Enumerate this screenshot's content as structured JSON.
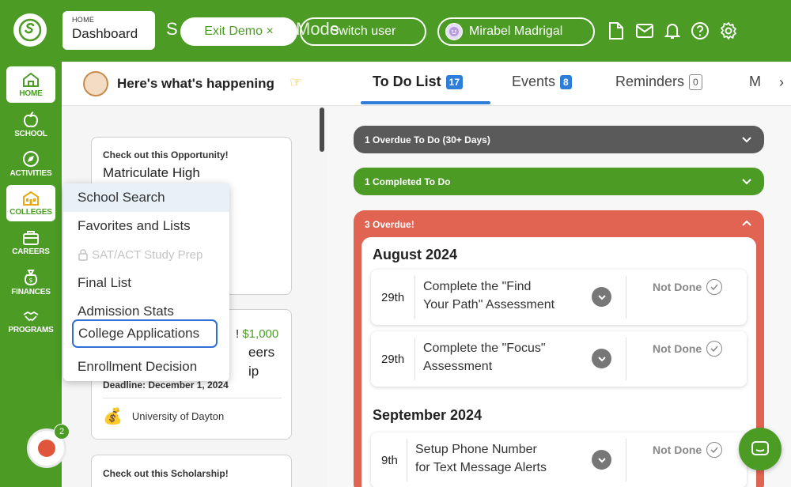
{
  "header": {
    "breadcrumb_small": "HOME",
    "breadcrumb_title": "Dashboard",
    "demo_mode_prefix": "S",
    "demo_mode_suffix": "Mode",
    "exit_demo_label": "Exit Demo ×",
    "switch_user_label": "Switch user",
    "user_name": "Mirabel Madrigal",
    "brand_color": "#4b9b25",
    "icons": [
      "document-icon",
      "mail-icon",
      "bell-icon",
      "help-icon",
      "settings-icon"
    ]
  },
  "sidebar": {
    "items": [
      {
        "label": "HOME",
        "icon": "home-icon"
      },
      {
        "label": "SCHOOL",
        "icon": "apple-icon"
      },
      {
        "label": "ACTIVITIES",
        "icon": "compass-icon"
      },
      {
        "label": "COLLEGES",
        "icon": "college-icon"
      },
      {
        "label": "CAREERS",
        "icon": "briefcase-icon"
      },
      {
        "label": "FINANCES",
        "icon": "money-bag-icon"
      },
      {
        "label": "PROGRAMS",
        "icon": "handshake-icon"
      }
    ],
    "record_badge": "2"
  },
  "feed": {
    "title": "Here's what's happening",
    "cards": [
      {
        "kicker": "Check out this Opportunity!",
        "title": "Matriculate High"
      },
      {
        "kicker": "",
        "title_prefix": "!",
        "money": "$1,000",
        "title_line2": "eers",
        "title_line3": "ip",
        "deadline": "Deadline: December 1, 2024",
        "org": "University of Dayton"
      },
      {
        "kicker": "Check out this Scholarship!"
      }
    ]
  },
  "colleges_menu": {
    "items": [
      {
        "label": "School Search",
        "state": "hover"
      },
      {
        "label": "Favorites and Lists",
        "state": "normal"
      },
      {
        "label": "SAT/ACT Study Prep",
        "state": "disabled"
      },
      {
        "label": "Final List",
        "state": "normal"
      },
      {
        "label": "Admission Stats",
        "state": "normal"
      },
      {
        "label": "College Applications",
        "state": "focused"
      },
      {
        "label": "Enrollment Decision",
        "state": "normal"
      }
    ]
  },
  "main": {
    "tabs": [
      {
        "label": "To Do List",
        "count": "17",
        "active": true
      },
      {
        "label": "Events",
        "count": "8",
        "active": false
      },
      {
        "label": "Reminders",
        "count": "0",
        "active": false
      },
      {
        "label": "M",
        "count": "",
        "active": false
      }
    ],
    "sections": {
      "overdue_30": "1 Overdue To Do (30+ Days)",
      "completed": "1 Completed To Do",
      "overdue": "3 Overdue!"
    },
    "months": [
      {
        "name": "August 2024",
        "todos": [
          {
            "day": "29th",
            "task_line1": "Complete the \"Find",
            "task_line2": "Your Path\" Assessment",
            "status": "Not Done"
          },
          {
            "day": "29th",
            "task_line1": "Complete the \"Focus\"",
            "task_line2": "Assessment",
            "status": "Not Done"
          }
        ]
      },
      {
        "name": "September 2024",
        "todos": [
          {
            "day": "9th",
            "task_line1": "Setup Phone Number",
            "task_line2": "for Text Message Alerts",
            "status": "Not Done"
          }
        ]
      }
    ],
    "colors": {
      "overdue_red": "#e16352",
      "gray_bar": "#5a5a5a",
      "tab_blue": "#2e7dd9"
    }
  }
}
